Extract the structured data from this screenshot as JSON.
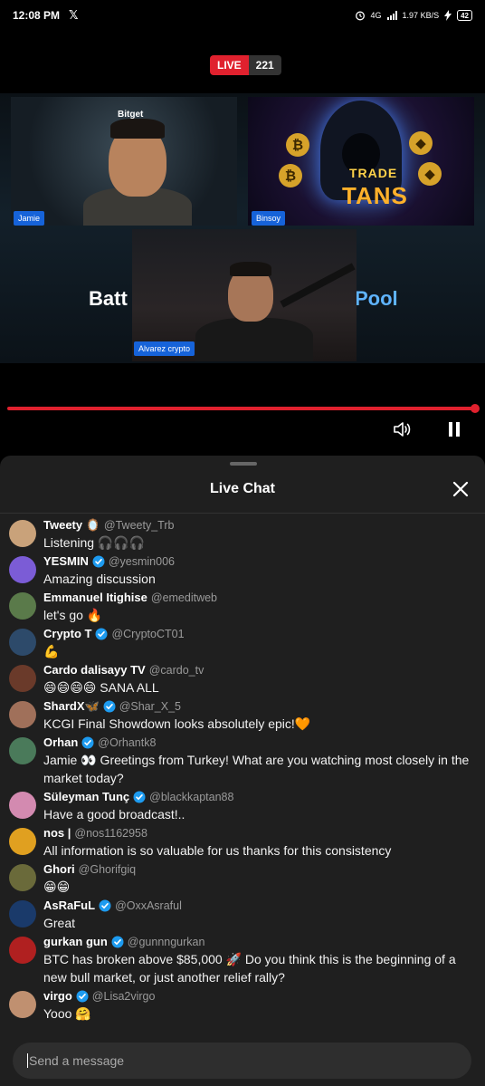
{
  "status": {
    "time": "12:08 PM",
    "app_glyph": "𝕏",
    "network": "4G",
    "speed": "1.97",
    "speed_unit": "KB/S",
    "battery": "42"
  },
  "live": {
    "label": "LIVE",
    "count": "221"
  },
  "video": {
    "bg_left_text": "Batt",
    "bg_right_text": "Pool",
    "sponsor": "Bitget",
    "trade_text": "TRADE",
    "titans_text": "TANS",
    "participants": [
      "Jamie",
      "Binsoy",
      "Alvarez crypto"
    ],
    "progress_fraction": 1.0
  },
  "chat": {
    "title": "Live Chat",
    "messages": [
      {
        "name": "Tweety 🪞",
        "handle": "@Tweety_Trb",
        "verified": false,
        "text": "Listening 🎧🎧🎧",
        "avatar_color": "#c9a27a"
      },
      {
        "name": "YESMIN",
        "handle": "@yesmin006",
        "verified": true,
        "text": "Amazing discussion",
        "avatar_color": "#7b5cd6"
      },
      {
        "name": "Emmanuel Itighise",
        "handle": "@emeditweb",
        "verified": false,
        "text": "let's go 🔥",
        "avatar_color": "#5a7a4a"
      },
      {
        "name": "Crypto T",
        "handle": "@CryptoCT01",
        "verified": true,
        "text": "💪",
        "avatar_color": "#2d4a6a"
      },
      {
        "name": "Cardo dalisayy TV",
        "handle": "@cardo_tv",
        "verified": false,
        "text": "😄😄😄😄 SANA ALL",
        "avatar_color": "#6a3a2a"
      },
      {
        "name": "ShardX🦋",
        "handle": "@Shar_X_5",
        "verified": true,
        "text": "KCGI Final Showdown looks absolutely epic!🧡",
        "avatar_color": "#a0705a"
      },
      {
        "name": "Orhan",
        "handle": "@Orhantk8",
        "verified": true,
        "text": "Jamie 👀 Greetings from Turkey! What are you watching most closely in the market today?",
        "avatar_color": "#4a7a5a"
      },
      {
        "name": "Süleyman Tunç",
        "handle": "@blackkaptan88",
        "verified": true,
        "text": "Have a good broadcast!..",
        "avatar_color": "#d38ab0"
      },
      {
        "name": "nos |",
        "handle": "@nos1162958",
        "verified": false,
        "text": "All information is so valuable for us thanks for this consistency",
        "avatar_color": "#e0a020"
      },
      {
        "name": "Ghori",
        "handle": "@Ghorifgiq",
        "verified": false,
        "text": "😁😁",
        "avatar_color": "#6a6a3a"
      },
      {
        "name": "AsRaFuL",
        "handle": "@OxxAsraful",
        "verified": true,
        "text": "Great",
        "avatar_color": "#1a3a6a"
      },
      {
        "name": "gurkan gun",
        "handle": "@gunnngurkan",
        "verified": true,
        "text": "BTC has broken above $85,000 🚀 Do you think this is the beginning of a new bull market, or just another relief rally?",
        "avatar_color": "#b02020"
      },
      {
        "name": "virgo",
        "handle": "@Lisa2virgo",
        "verified": true,
        "text": "Yooo 🤗",
        "avatar_color": "#c09070"
      }
    ]
  },
  "composer": {
    "placeholder": "Send a message"
  }
}
